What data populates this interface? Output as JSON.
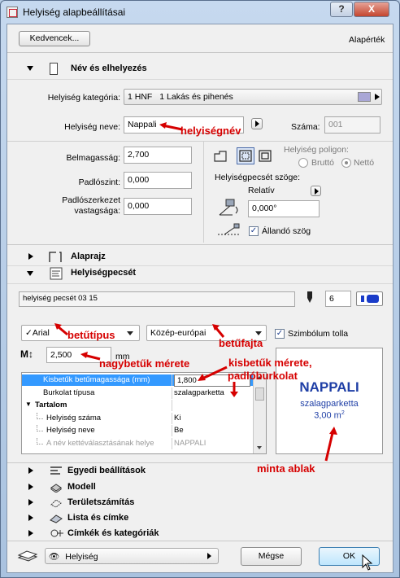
{
  "window": {
    "title": "Helyiség alapbeállításai",
    "help_label": "?",
    "close_label": "X"
  },
  "top": {
    "favorites_label": "Kedvencek...",
    "defaults_label": "Alapérték"
  },
  "section_name": {
    "title": "Név és elhelyezés",
    "category_label": "Helyiség kategória:",
    "category_code": "1 HNF",
    "category_value": "1 Lakás és pihenés",
    "name_label": "Helyiség neve:",
    "name_value": "Nappali",
    "number_label": "Száma:",
    "number_value": "001"
  },
  "geometry": {
    "height_label": "Belmagasság:",
    "height_value": "2,700",
    "floor_level_label": "Padlószint:",
    "floor_level_value": "0,000",
    "floor_structure_label": "Padlószerkezet vastagsága:",
    "floor_structure_value": "0,000",
    "polygon_label": "Helyiség poligon:",
    "gross_label": "Bruttó",
    "net_label": "Nettó",
    "stamp_angle_label": "Helyiségpecsét szöge:",
    "relative_label": "Relatív",
    "angle_value": "0,000°",
    "fixed_angle_label": "Állandó szög",
    "fixed_angle_checked": true
  },
  "sections": {
    "floorplan": "Alaprajz",
    "stamp": "Helyiségpecsét",
    "custom": "Egyedi beállítások",
    "model": "Modell",
    "area": "Területszámítás",
    "list_label": "Lista és címke",
    "tags": "Címkék és kategóriák"
  },
  "stamp": {
    "name": "helyiség pecsét 03 15",
    "pen_value": "6",
    "font_value": "Arial",
    "encoding_value": "Közép-európai",
    "symbol_color_label": "Szimbólum tolla",
    "symbol_color_checked": true,
    "size_value": "2,500",
    "size_unit": "mm",
    "table": [
      {
        "label": "Kisbetűk betűmagassága (mm)",
        "value": "1,800",
        "selected": true,
        "indent": 1
      },
      {
        "label": "Burkolat típusa",
        "value": "szalagparketta",
        "selected": false,
        "indent": 1
      },
      {
        "label": "Tartalom",
        "value": "",
        "selected": false,
        "indent": 0,
        "bold": true
      },
      {
        "label": "Helyiség száma",
        "value": "Ki",
        "selected": false,
        "indent": 2
      },
      {
        "label": "Helyiség neve",
        "value": "Be",
        "selected": false,
        "indent": 2
      },
      {
        "label": "A név kettéválasztásának helye",
        "value": "NAPPALI",
        "selected": false,
        "indent": 2,
        "disabled": true
      }
    ],
    "preview": {
      "name": "NAPPALI",
      "floor": "szalagparketta",
      "area": "3,00 m",
      "area_sup": "2"
    }
  },
  "annotations": {
    "room_name": "helyiségnév",
    "font_type": "betűtípus",
    "char_encoding": "betűfajta",
    "uppercase_size": "nagybetűk mérete",
    "lowercase_size": "kisbetűk mérete,",
    "floor_covering": "padlóburkolat",
    "preview_window": "minta ablak"
  },
  "bottom": {
    "layer_value": "Helyiség",
    "cancel_label": "Mégse",
    "ok_label": "OK"
  },
  "colors": {
    "annotation": "#d60000",
    "selection": "#3399ff",
    "preview_text": "#1f3fa6"
  }
}
